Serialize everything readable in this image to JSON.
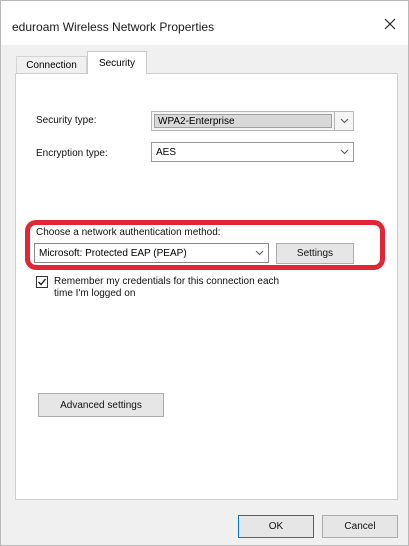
{
  "window": {
    "title": "eduroam Wireless Network Properties"
  },
  "tabs": [
    {
      "label": "Connection",
      "selected": false
    },
    {
      "label": "Security",
      "selected": true
    }
  ],
  "security": {
    "security_type_label": "Security type:",
    "security_type_value": "WPA2-Enterprise",
    "encryption_type_label": "Encryption type:",
    "encryption_type_value": "AES",
    "auth_method_label": "Choose a network authentication method:",
    "auth_method_value": "Microsoft: Protected EAP (PEAP)",
    "settings_button": "Settings",
    "remember_credentials_line1": "Remember my credentials for this connection each",
    "remember_credentials_line2": "time I'm logged on",
    "remember_credentials_checked": true,
    "advanced_settings_button": "Advanced settings"
  },
  "footer": {
    "ok_button": "OK",
    "cancel_button": "Cancel"
  },
  "colors": {
    "highlight": "#e32636",
    "focus_border": "#0078d7"
  },
  "icons": {
    "close": "close-icon",
    "dropdown": "chevron-down-icon",
    "check": "checkmark-icon"
  }
}
